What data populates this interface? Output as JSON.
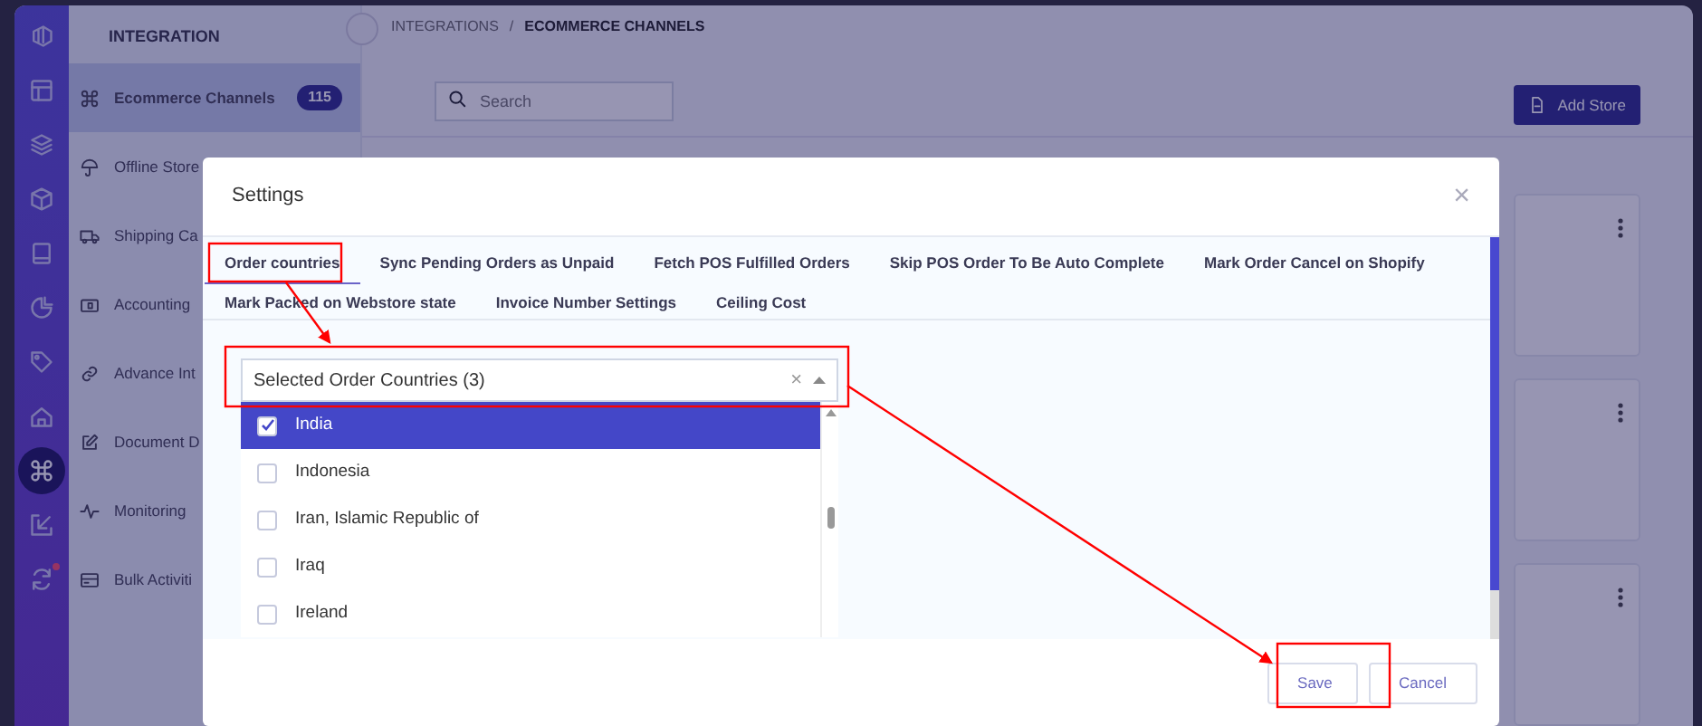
{
  "rail": {
    "items": [
      {
        "kind": "logo",
        "selected": false,
        "dot": false
      },
      {
        "kind": "layout",
        "selected": false,
        "dot": false
      },
      {
        "kind": "layers",
        "selected": false,
        "dot": false
      },
      {
        "kind": "cube",
        "selected": false,
        "dot": false
      },
      {
        "kind": "book",
        "selected": false,
        "dot": false
      },
      {
        "kind": "pie",
        "selected": false,
        "dot": false
      },
      {
        "kind": "tag",
        "selected": false,
        "dot": false
      },
      {
        "kind": "home",
        "selected": false,
        "dot": false
      },
      {
        "kind": "command",
        "selected": true,
        "dot": false
      },
      {
        "kind": "import",
        "selected": false,
        "dot": false
      },
      {
        "kind": "sync",
        "selected": false,
        "dot": true
      }
    ]
  },
  "sidebar": {
    "heading": "INTEGRATION",
    "items": [
      {
        "kind": "command",
        "label": "Ecommerce Channels",
        "count": "115",
        "selected": true
      },
      {
        "kind": "umbrella",
        "label": "Offline Store",
        "selected": false
      },
      {
        "kind": "truck",
        "label": "Shipping Ca",
        "selected": false
      },
      {
        "kind": "wallet",
        "label": "Accounting",
        "selected": false
      },
      {
        "kind": "link",
        "label": "Advance Int",
        "selected": false
      },
      {
        "kind": "edit",
        "label": "Document D",
        "selected": false
      },
      {
        "kind": "activity",
        "label": "Monitoring",
        "selected": false
      },
      {
        "kind": "card",
        "label": "Bulk Activiti",
        "selected": false
      }
    ]
  },
  "breadcrumb": [
    "INTEGRATIONS",
    "ECOMMERCE CHANNELS"
  ],
  "breadcrumb_separator": "/",
  "search": {
    "placeholder": "Search"
  },
  "add_button": "Add Store",
  "modal": {
    "title": "Settings",
    "close": "×",
    "tabs": [
      {
        "label": "Order countries",
        "selected": true
      },
      {
        "label": "Sync Pending Orders as Unpaid",
        "selected": false
      },
      {
        "label": "Fetch POS Fulfilled Orders",
        "selected": false
      },
      {
        "label": "Skip POS Order To Be Auto Complete",
        "selected": false
      },
      {
        "label": "Mark Order Cancel on Shopify",
        "selected": false
      },
      {
        "label": "Mark Packed on Webstore state",
        "selected": false
      },
      {
        "label": "Invoice Number Settings",
        "selected": false
      },
      {
        "label": "Ceiling Cost",
        "selected": false
      }
    ],
    "select": {
      "value": "Selected Order Countries (3)",
      "clear": "×",
      "expanded": true,
      "options": [
        {
          "label": "India",
          "checked": true,
          "selected": true
        },
        {
          "label": "Indonesia",
          "checked": false,
          "selected": false
        },
        {
          "label": "Iran, Islamic Republic of",
          "checked": false,
          "selected": false
        },
        {
          "label": "Iraq",
          "checked": false,
          "selected": false
        },
        {
          "label": "Ireland",
          "checked": false,
          "selected": false
        }
      ]
    },
    "buttons": [
      "Save",
      "Cancel"
    ]
  }
}
